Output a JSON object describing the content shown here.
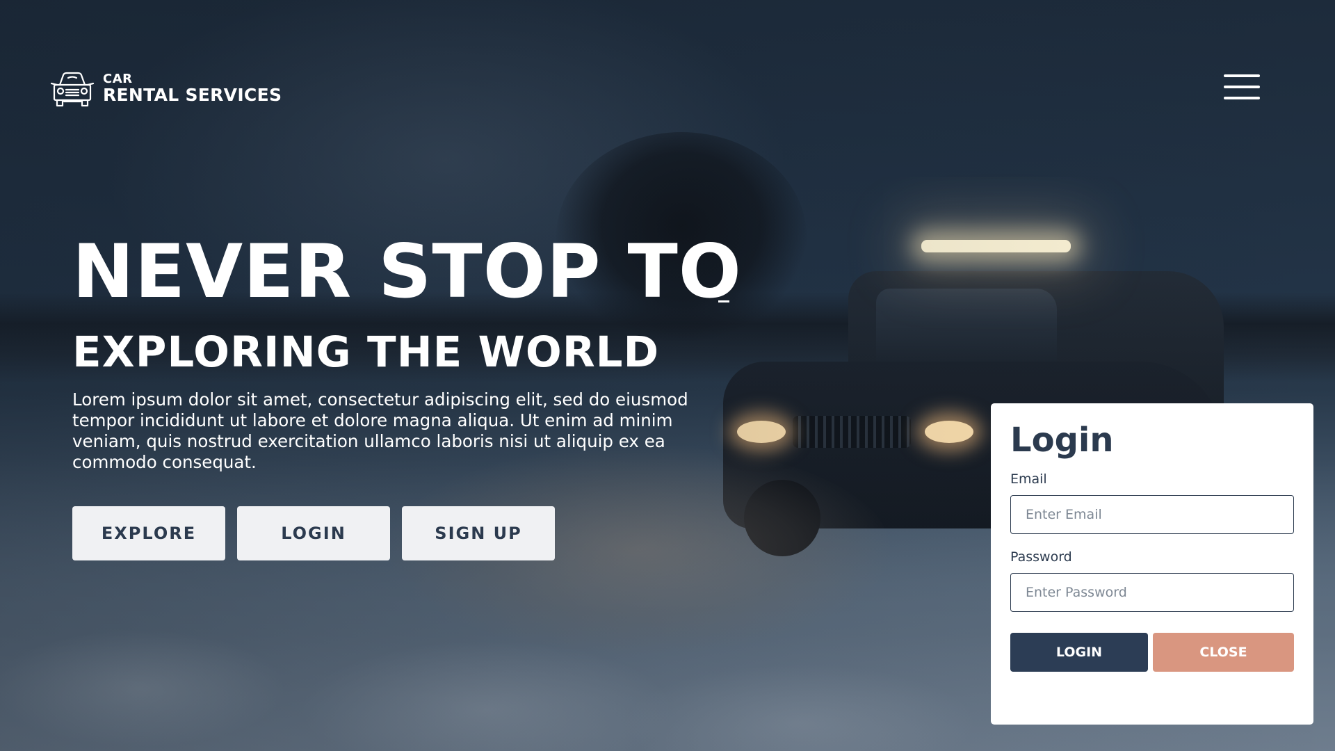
{
  "brand": {
    "small": "CAR",
    "big": "RENTAL SERVICES",
    "logo_icon": "car-icon"
  },
  "nav": {
    "menu_icon": "hamburger-menu-icon"
  },
  "hero": {
    "title": "NEVER STOP TO",
    "subtitle": "EXPLORING THE WORLD",
    "text": "Lorem ipsum dolor sit amet, consectetur adipiscing elit, sed do eiusmod tempor incididunt ut labore et dolore magna aliqua. Ut enim ad minim veniam, quis nostrud exercitation ullamco laboris nisi ut aliquip ex ea commodo consequat.",
    "buttons": {
      "explore": "EXPLORE",
      "login": "LOGIN",
      "signup": "SIGN UP"
    }
  },
  "login_form": {
    "title": "Login",
    "email_label": "Email",
    "email_placeholder": "Enter Email",
    "email_value": "",
    "password_label": "Password",
    "password_placeholder": "Enter Password",
    "password_value": "",
    "login_button": "LOGIN",
    "close_button": "CLOSE"
  },
  "colors": {
    "primary_dark": "#2c3d55",
    "accent_salmon": "#d99680",
    "button_light": "#f0f1f3",
    "text_white": "#ffffff"
  }
}
